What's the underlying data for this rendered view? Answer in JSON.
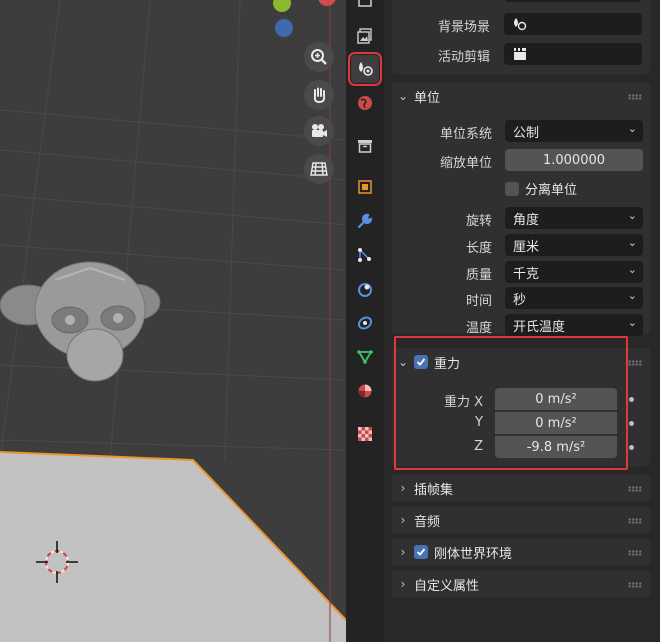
{
  "scene": {
    "background_label": "背景场景",
    "active_clip_label": "活动剪辑"
  },
  "units": {
    "title": "单位",
    "unit_system_label": "单位系统",
    "unit_system_value": "公制",
    "unit_scale_label": "缩放单位",
    "unit_scale_value": "1.000000",
    "separate_units_label": "分离单位",
    "rotation_label": "旋转",
    "rotation_value": "角度",
    "length_label": "长度",
    "length_value": "厘米",
    "mass_label": "质量",
    "mass_value": "千克",
    "time_label": "时间",
    "time_value": "秒",
    "temperature_label": "温度",
    "temperature_value": "开氏温度"
  },
  "gravity": {
    "title": "重力",
    "enabled": true,
    "x_label": "重力 X",
    "x_value": "0 m/s²",
    "y_label": "Y",
    "y_value": "0 m/s²",
    "z_label": "Z",
    "z_value": "-9.8 m/s²"
  },
  "collapsed_sections": {
    "keying_sets": "插帧集",
    "audio": "音频",
    "rigid_body_world": "刚体世界环境",
    "custom_properties": "自定义属性"
  },
  "colors": {
    "accent": "#4772b3",
    "highlight": "#e0383e",
    "viewport_bg": "#3d3d3d",
    "panel_bg": "#303030"
  },
  "icons": {
    "viewport_tools": [
      "zoom-icon",
      "hand-pan-icon",
      "camera-icon",
      "grid-icon"
    ],
    "property_tabs": [
      "render-icon",
      "output-icon",
      "view-layer-icon",
      "scene-icon",
      "world-icon",
      "collection-icon",
      "object-icon",
      "modifier-icon",
      "particles-icon",
      "physics-icon",
      "constraints-icon",
      "data-icon",
      "material-icon",
      "texture-icon"
    ]
  }
}
